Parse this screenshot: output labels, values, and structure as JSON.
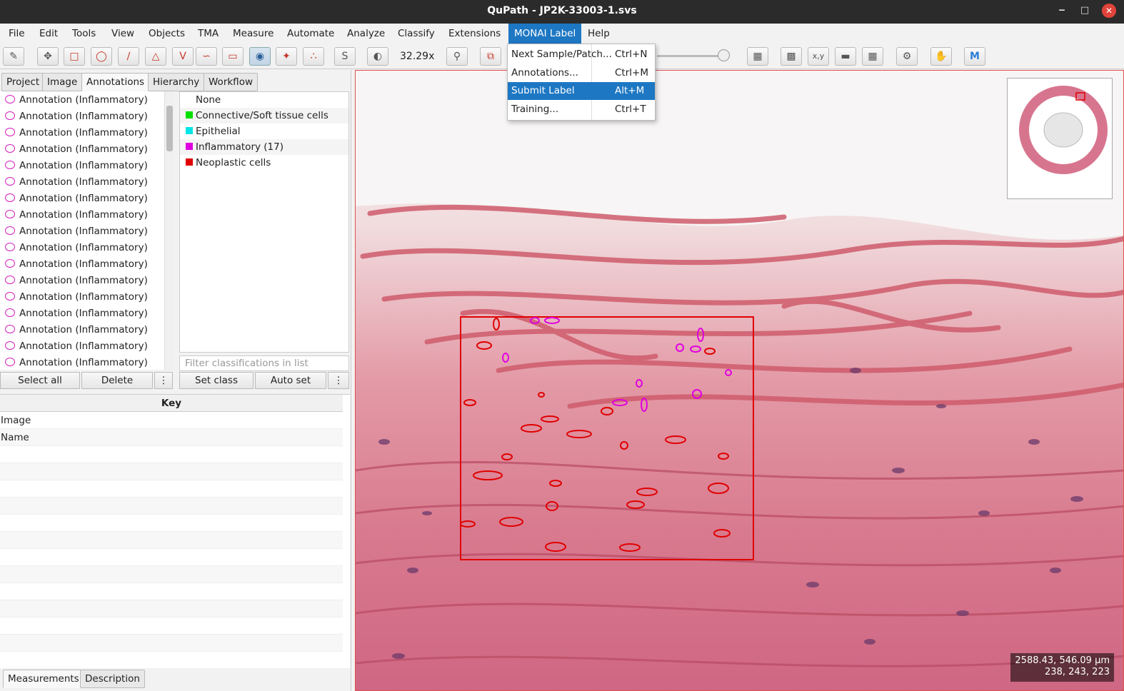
{
  "window": {
    "title": "QuPath - JP2K-33003-1.svs",
    "minimize": "‒",
    "maximize": "□",
    "close": "✕"
  },
  "menubar": [
    "File",
    "Edit",
    "Tools",
    "View",
    "Objects",
    "TMA",
    "Measure",
    "Automate",
    "Analyze",
    "Classify",
    "Extensions",
    "MONAI Label",
    "Help"
  ],
  "toolbar": {
    "zoom": "32.29x",
    "brush_label": "S",
    "icons": [
      "ruler-icon",
      "move-icon",
      "rectangle-icon",
      "ellipse-icon",
      "line-icon",
      "polygon-icon",
      "polyline-icon",
      "brush-icon",
      "rect-select-icon",
      "point-icon",
      "wand-icon",
      "points-icon",
      "selection-mode-icon",
      "contrast-icon",
      "zoom-icon",
      "overlay-icon",
      "table-icon",
      "cursor-icon",
      "xy-icon",
      "scalebar-icon",
      "grid-icon",
      "settings-icon",
      "hand-icon",
      "monai-icon"
    ],
    "slider_level": 0.93
  },
  "dropdown": {
    "items": [
      {
        "label": "Next Sample/Patch...",
        "accel": "Ctrl+N"
      },
      {
        "label": "Annotations...",
        "accel": "Ctrl+M"
      },
      {
        "label": "Submit Label",
        "accel": "Alt+M"
      },
      {
        "label": "Training...",
        "accel": "Ctrl+T"
      }
    ]
  },
  "tabs": [
    "Project",
    "Image",
    "Annotations",
    "Hierarchy",
    "Workflow"
  ],
  "annotations": [
    "Annotation (Inflammatory)",
    "Annotation (Inflammatory)",
    "Annotation (Inflammatory)",
    "Annotation (Inflammatory)",
    "Annotation (Inflammatory)",
    "Annotation (Inflammatory)",
    "Annotation (Inflammatory)",
    "Annotation (Inflammatory)",
    "Annotation (Inflammatory)",
    "Annotation (Inflammatory)",
    "Annotation (Inflammatory)",
    "Annotation (Inflammatory)",
    "Annotation (Inflammatory)",
    "Annotation (Inflammatory)",
    "Annotation (Inflammatory)",
    "Annotation (Inflammatory)",
    "Annotation (Inflammatory)"
  ],
  "classes": [
    {
      "label": "None",
      "color": ""
    },
    {
      "label": "Connective/Soft tissue cells",
      "color": "#00e000"
    },
    {
      "label": "Epithelial",
      "color": "#00e5e5"
    },
    {
      "label": "Inflammatory (17)",
      "color": "#e000e0"
    },
    {
      "label": "Neoplastic cells",
      "color": "#e00000"
    }
  ],
  "filter_placeholder": "Filter classifications in list",
  "buttons": {
    "select_all": "Select all",
    "delete": "Delete",
    "more": "⋮",
    "set_class": "Set class",
    "auto_set": "Auto set"
  },
  "key_table": {
    "header": "Key",
    "rows": [
      "Image",
      "Name"
    ]
  },
  "bottom_tabs": [
    "Measurements",
    "Description"
  ],
  "viewer": {
    "coords_line1": "2588.43, 546.09 µm",
    "coords_line2": "238, 243, 223"
  }
}
